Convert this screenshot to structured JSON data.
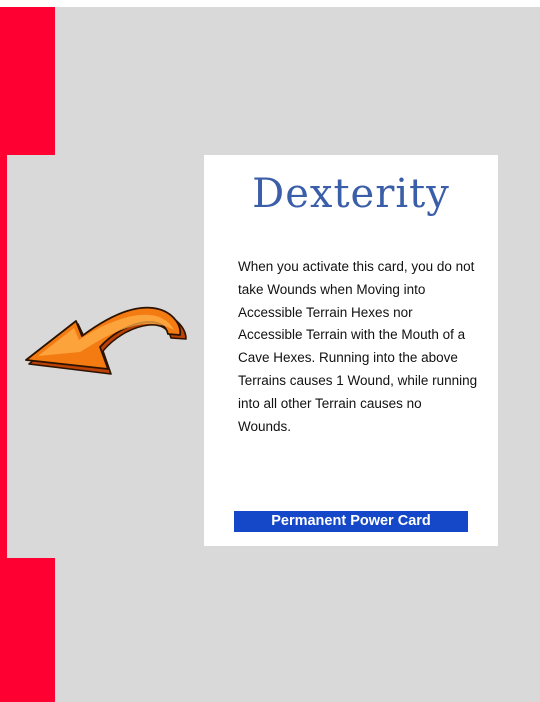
{
  "card": {
    "title": "Dexterity",
    "body": "When you activate this card, you do not take Wounds when Moving into Accessible Terrain Hexes nor Accessible Terrain with the Mouth of a Cave Hexes.  Running into the above Terrains causes 1 Wound, while running into all other Terrain causes no Wounds.",
    "footer": "Permanent Power Card"
  },
  "colors": {
    "background": "#d9d9d9",
    "side_bar": "#ff0033",
    "title": "#3b5ea8",
    "footer_band": "#1547c9",
    "arrow": "#f47a12"
  },
  "icons": {
    "arrow": "left-pointing-arrow-icon"
  }
}
